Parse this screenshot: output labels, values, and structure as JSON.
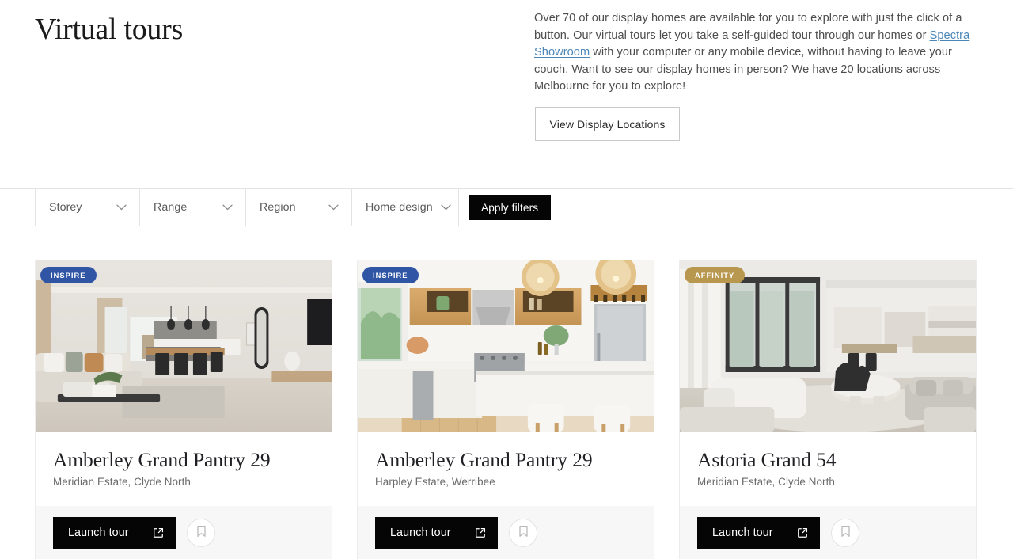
{
  "hero": {
    "title": "Virtual tours",
    "body_part1": "Over 70 of our display homes are available for you to explore with just the click of a button. Our virtual tours let you take a self-guided tour through our homes or ",
    "link_text": "Spectra Showroom",
    "body_part2": " with your computer or any mobile device, without having to leave your couch. Want to see our display homes in person? We have 20 locations across Melbourne for you to explore!",
    "locations_button": "View Display Locations"
  },
  "filters": {
    "storey": "Storey",
    "range": "Range",
    "region": "Region",
    "home_design": "Home design",
    "apply": "Apply filters",
    "chevron_icon": "chevron-down-icon"
  },
  "colors": {
    "badge_inspire": "#2f55a4",
    "badge_affinity": "#b8974f",
    "button_black": "#050505",
    "link_blue": "#4a86b8",
    "footer_gray": "#f7f7f7"
  },
  "cards": [
    {
      "badge": "INSPIRE",
      "badge_style": "inspire",
      "title": "Amberley Grand Pantry 29",
      "subtitle": "Meridian Estate, Clyde North",
      "launch_label": "Launch tour",
      "launch_icon": "external-link-icon",
      "save_icon": "bookmark-icon",
      "image_alt": "open-plan living and dining interior"
    },
    {
      "badge": "INSPIRE",
      "badge_style": "inspire",
      "title": "Amberley Grand Pantry 29",
      "subtitle": "Harpley Estate, Werribee",
      "launch_label": "Launch tour",
      "launch_icon": "external-link-icon",
      "save_icon": "bookmark-icon",
      "image_alt": "white and timber kitchen with island bench"
    },
    {
      "badge": "AFFINITY",
      "badge_style": "affinity",
      "title": "Astoria Grand 54",
      "subtitle": "Meridian Estate, Clyde North",
      "launch_label": "Launch tour",
      "launch_icon": "external-link-icon",
      "save_icon": "bookmark-icon",
      "image_alt": "living room with stacker doors to alfresco"
    }
  ]
}
